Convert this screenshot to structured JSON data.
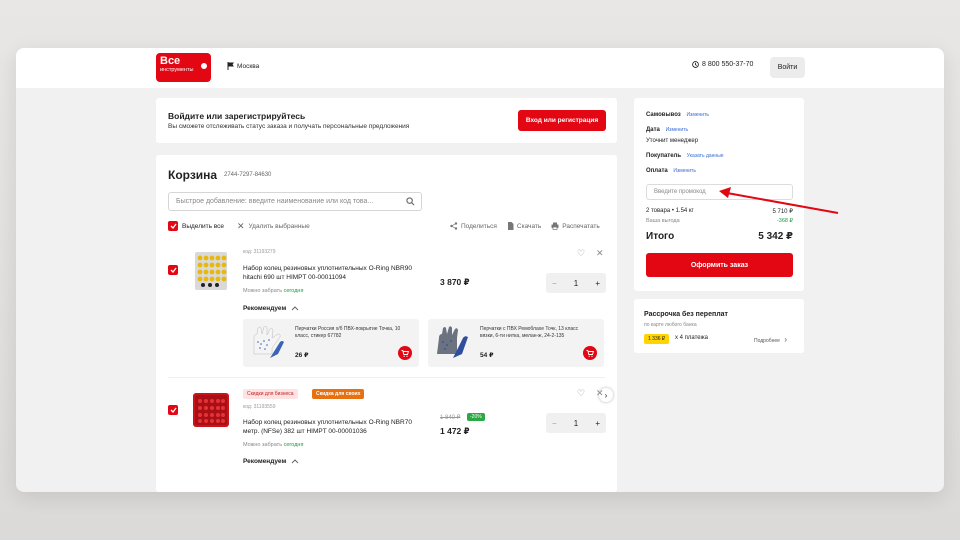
{
  "header": {
    "logo_line1": "Все",
    "logo_line2": "инструменты",
    "logo_badge": "ru",
    "city": "Москва",
    "phone": "8 800 550-37-70",
    "login": "Войти"
  },
  "auth": {
    "title": "Войдите или зарегистрируйтесь",
    "subtitle": "Вы сможете отслеживать статус заказа и получать персональные предложения",
    "button": "Вход или регистрация"
  },
  "cart": {
    "title": "Корзина",
    "id": "2744-7297-84630",
    "quick_add_placeholder": "Быстрое добавление: введите наименование или код това...",
    "select_all": "Выделить все",
    "delete_selected": "Удалить выбранные",
    "share": "Поделиться",
    "download": "Скачать",
    "print": "Распечатать",
    "items": [
      {
        "code": "код: 31193279",
        "name": "Набор колец резиновых уплотнительных O-Ring NBR90 hitachi 690 шт HIMPT 00-00011094",
        "availability": "Можно забрать",
        "availability_when": "сегодня",
        "price": "3 870 ₽",
        "qty": "1",
        "recommend": "Рекомендуем"
      },
      {
        "badge1": "Скидки для бизнеса",
        "badge2": "Скидка для своих",
        "code": "код: 31193559",
        "name": "Набор колец резиновых уплотнительных O-Ring NBR70 метр. (NFSe) 382 шт HIMPT 00-00001036",
        "availability": "Можно забрать",
        "availability_when": "сегодня",
        "old_price": "1 840 ₽",
        "discount": "-20%",
        "price": "1 472 ₽",
        "qty": "1",
        "recommend": "Рекомендуем"
      }
    ],
    "recommendations": [
      {
        "name": "Перчатки Россия х/б ПВХ-покрытие Точка, 10 класс, стикер 67782",
        "price": "26 ₽"
      },
      {
        "name": "Перчатки с ПВХ Ремоблахе Точк, 13 класс вязки, 6-ти нитка, мелан-ж, 24-2-135",
        "price": "54 ₽"
      }
    ]
  },
  "summary": {
    "pickup_label": "Самовывоз",
    "pickup_link": "Изменить",
    "date_label": "Дата",
    "date_link": "Изменить",
    "date_value": "Уточнит менеджер",
    "buyer_label": "Покупатель",
    "buyer_link": "Указать данные",
    "payment_label": "Оплата",
    "payment_link": "Изменить",
    "promo_placeholder": "Введите промокод",
    "goods_label": "2 товара • 1.54 кг",
    "goods_value": "5 710 ₽",
    "saving_label": "Ваша выгода",
    "saving_value": "-368 ₽",
    "total_label": "Итого",
    "total_value": "5 342 ₽",
    "checkout": "Оформить заказ"
  },
  "installment": {
    "title": "Рассрочка без переплат",
    "subtitle": "по карте любого банка",
    "amount": "1 336 ₽",
    "count": "х 4 платежа",
    "more": "Подробнее"
  },
  "colors": {
    "brand_red": "#e30613",
    "success_green": "#1a9b3c",
    "link_blue": "#3b6bd1",
    "orange_badge": "#e8700f",
    "yellow_badge": "#ffd400"
  }
}
